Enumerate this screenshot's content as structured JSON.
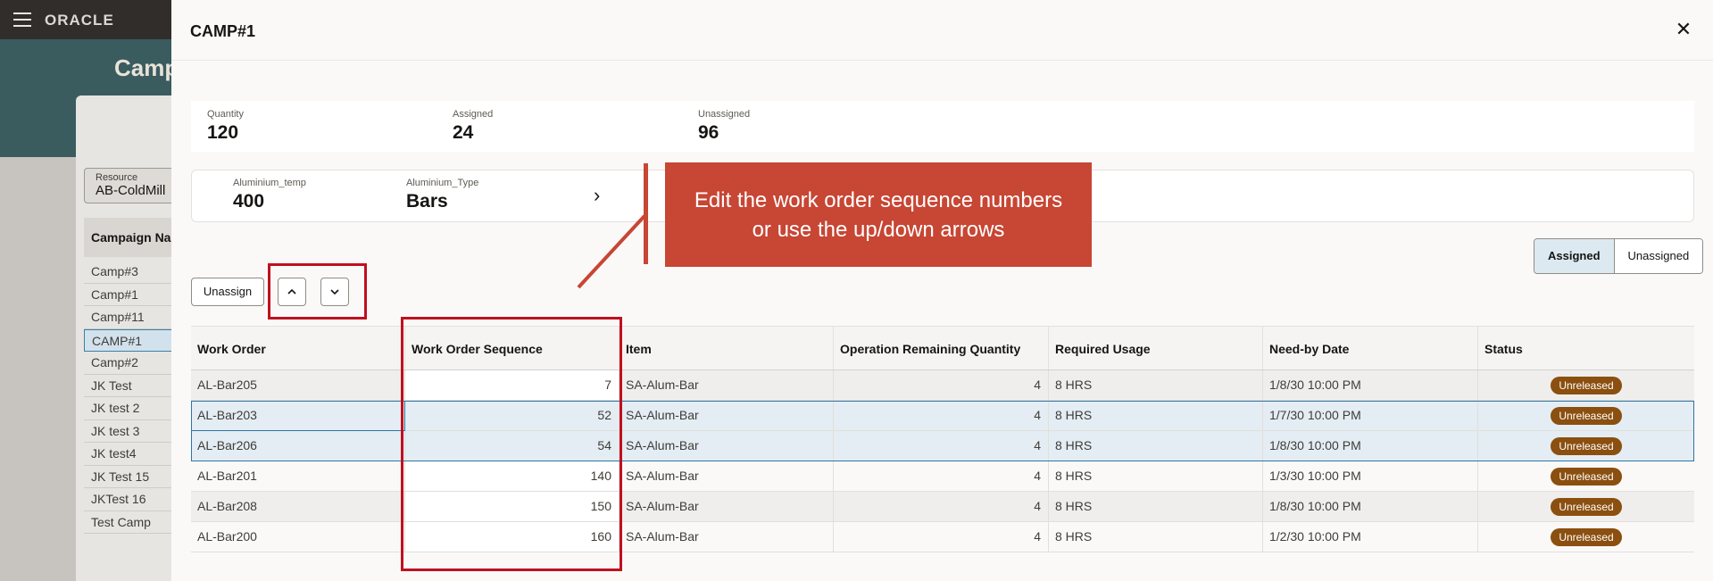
{
  "background": {
    "brand": "ORACLE",
    "page_title": "Camp",
    "resource": {
      "label": "Resource",
      "value": "AB-ColdMill"
    },
    "campaign_list_header": "Campaign Na",
    "campaigns": [
      "Camp#3",
      "Camp#1",
      "Camp#11",
      "CAMP#1",
      "Camp#2",
      "JK Test",
      "JK test 2",
      "JK test 3",
      "JK test4",
      "JK Test 15",
      "JKTest 16",
      "Test Camp"
    ],
    "selected_campaign_index": 3
  },
  "drawer": {
    "title": "CAMP#1",
    "close_icon": "close-icon",
    "summary": [
      {
        "label": "Quantity",
        "value": "120"
      },
      {
        "label": "Assigned",
        "value": "24"
      },
      {
        "label": "Unassigned",
        "value": "96"
      }
    ],
    "attributes": [
      {
        "label": "Aluminium_temp",
        "value": "400"
      },
      {
        "label": "Aluminium_Type",
        "value": "Bars"
      }
    ],
    "attributes_next_icon": "chevron-right-icon",
    "toggle": {
      "assigned": "Assigned",
      "unassigned": "Unassigned",
      "active": "assigned"
    },
    "toolbar": {
      "unassign_label": "Unassign",
      "move_up_icon": "chevron-up-icon",
      "move_down_icon": "chevron-down-icon"
    },
    "table": {
      "columns": [
        "Work Order",
        "Work Order Sequence",
        "Item",
        "Operation Remaining Quantity",
        "Required Usage",
        "Need-by Date",
        "Status"
      ],
      "rows": [
        [
          "AL-Bar205",
          "7",
          "SA-Alum-Bar",
          "4",
          "8 HRS",
          "1/8/30 10:00 PM",
          "Unreleased"
        ],
        [
          "AL-Bar203",
          "52",
          "SA-Alum-Bar",
          "4",
          "8 HRS",
          "1/7/30 10:00 PM",
          "Unreleased"
        ],
        [
          "AL-Bar206",
          "54",
          "SA-Alum-Bar",
          "4",
          "8 HRS",
          "1/8/30 10:00 PM",
          "Unreleased"
        ],
        [
          "AL-Bar201",
          "140",
          "SA-Alum-Bar",
          "4",
          "8 HRS",
          "1/3/30 10:00 PM",
          "Unreleased"
        ],
        [
          "AL-Bar208",
          "150",
          "SA-Alum-Bar",
          "4",
          "8 HRS",
          "1/8/30 10:00 PM",
          "Unreleased"
        ],
        [
          "AL-Bar200",
          "160",
          "SA-Alum-Bar",
          "4",
          "8 HRS",
          "1/2/30 10:00 PM",
          "Unreleased"
        ]
      ],
      "selected_rows": [
        1,
        2
      ]
    }
  },
  "callout": {
    "text_line1": "Edit the work order sequence numbers",
    "text_line2": "or use the up/down arrows"
  },
  "colors": {
    "accent_blue": "#2e75a4",
    "status_badge": "#8b4f0f",
    "annotation_red": "#c0101f",
    "callout_fill": "#c74634"
  }
}
